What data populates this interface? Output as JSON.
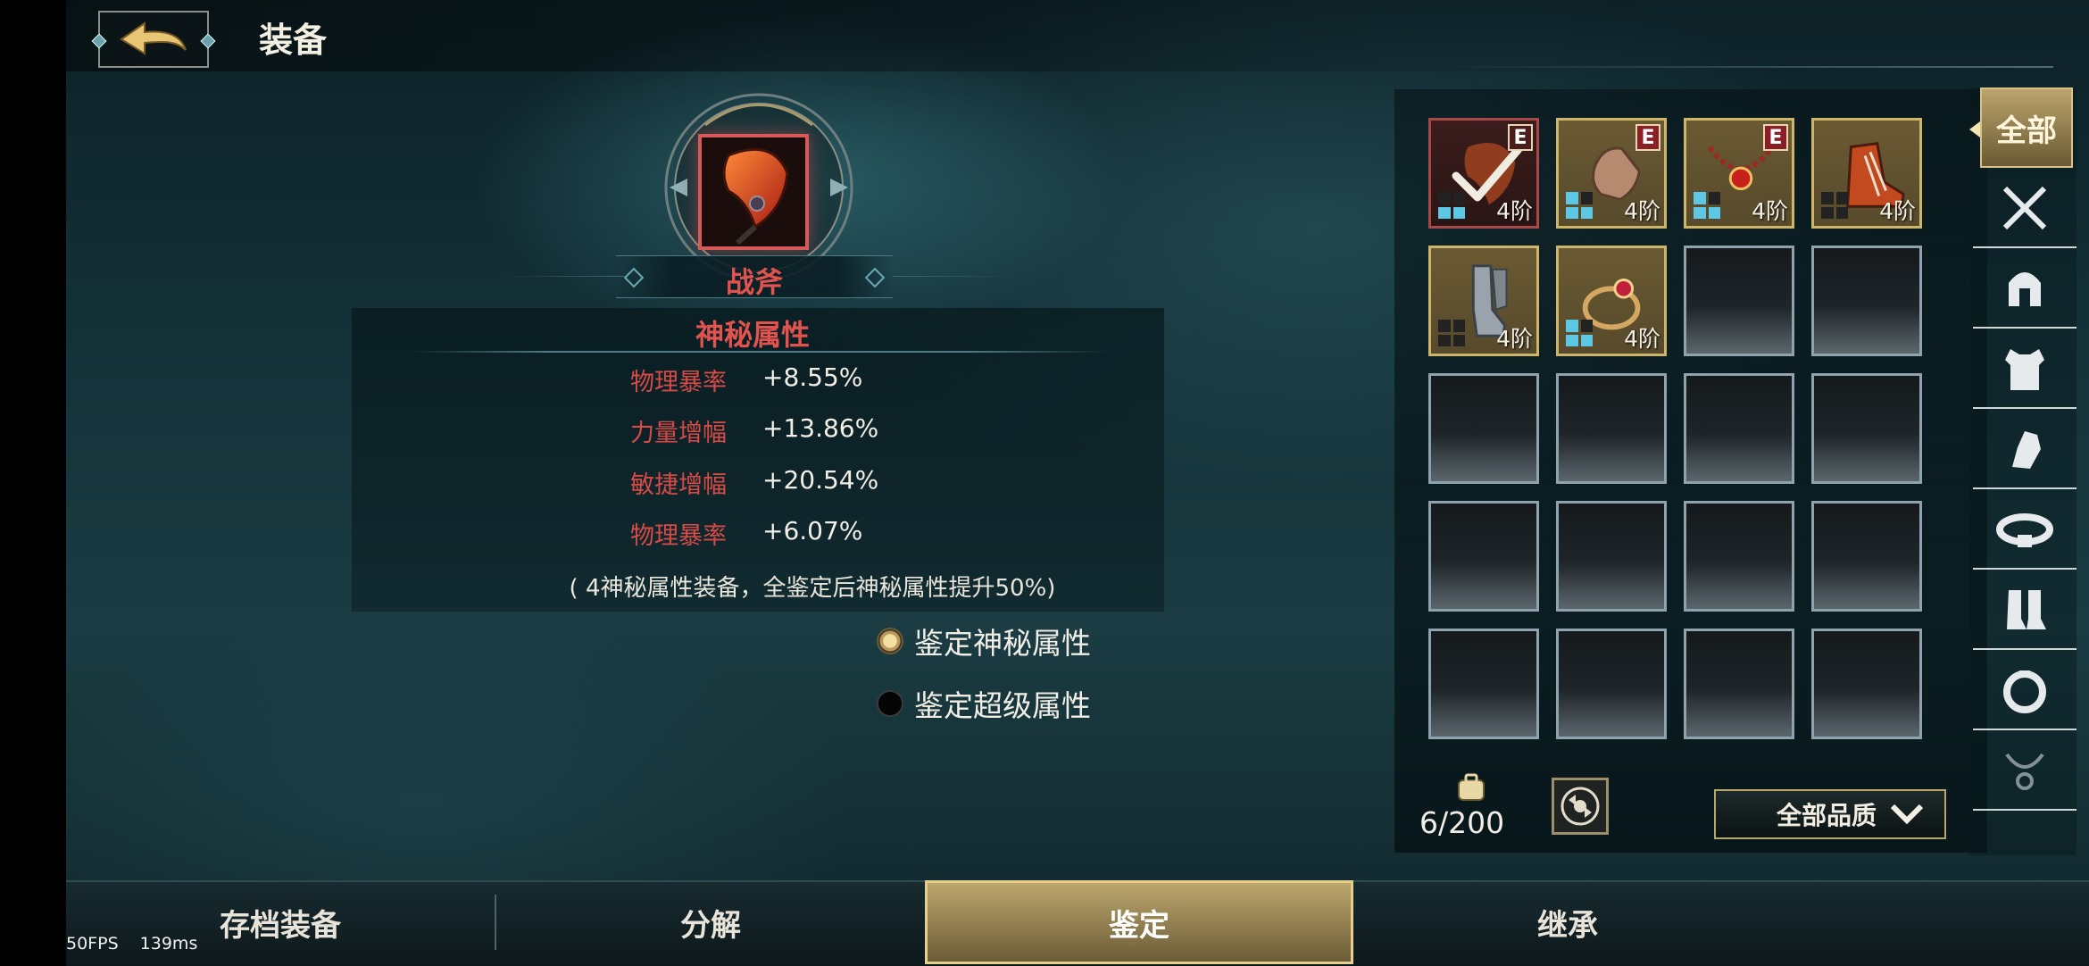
{
  "header": {
    "title": "装备",
    "back_icon": "back-arrow-icon"
  },
  "item": {
    "name": "战斧",
    "icon": "battle-axe-icon"
  },
  "attributes": {
    "section_title": "神秘属性",
    "rows": [
      {
        "name": "物理暴率",
        "value": "+8.55%"
      },
      {
        "name": "力量增幅",
        "value": "+13.86%"
      },
      {
        "name": "敏捷增幅",
        "value": "+20.54%"
      },
      {
        "name": "物理暴率",
        "value": "+6.07%"
      }
    ],
    "note": "( 4神秘属性装备，全鉴定后神秘属性提升50%)"
  },
  "options": [
    {
      "label": "鉴定神秘属性",
      "selected": true
    },
    {
      "label": "鉴定超级属性",
      "selected": false
    }
  ],
  "inventory": {
    "slots": [
      {
        "item": "battle-axe",
        "tier": "4阶",
        "badge": "E",
        "checked": true,
        "quality": "red"
      },
      {
        "item": "glove",
        "tier": "4阶",
        "badge": "E",
        "quality": "gold"
      },
      {
        "item": "necklace",
        "tier": "4阶",
        "badge": "E",
        "quality": "gold"
      },
      {
        "item": "boot",
        "tier": "4阶",
        "quality": "gold"
      },
      {
        "item": "greaves",
        "tier": "4阶",
        "quality": "gold"
      },
      {
        "item": "ring",
        "tier": "4阶",
        "quality": "gold"
      }
    ],
    "capacity_text": "6/200",
    "quality_filter": "全部品质"
  },
  "categories": [
    {
      "label": "全部",
      "icon": "all-icon"
    },
    {
      "icon": "crossed-swords-icon"
    },
    {
      "icon": "helmet-icon"
    },
    {
      "icon": "armor-icon"
    },
    {
      "icon": "gauntlet-icon"
    },
    {
      "icon": "belt-icon"
    },
    {
      "icon": "boots-icon"
    },
    {
      "icon": "ring-icon"
    },
    {
      "icon": "necklace-icon"
    }
  ],
  "tabs": [
    {
      "label": "存档装备"
    },
    {
      "label": "分解"
    },
    {
      "label": "鉴定",
      "active": true
    },
    {
      "label": "继承"
    }
  ],
  "debug": {
    "fps": "50FPS",
    "latency": "139ms"
  }
}
